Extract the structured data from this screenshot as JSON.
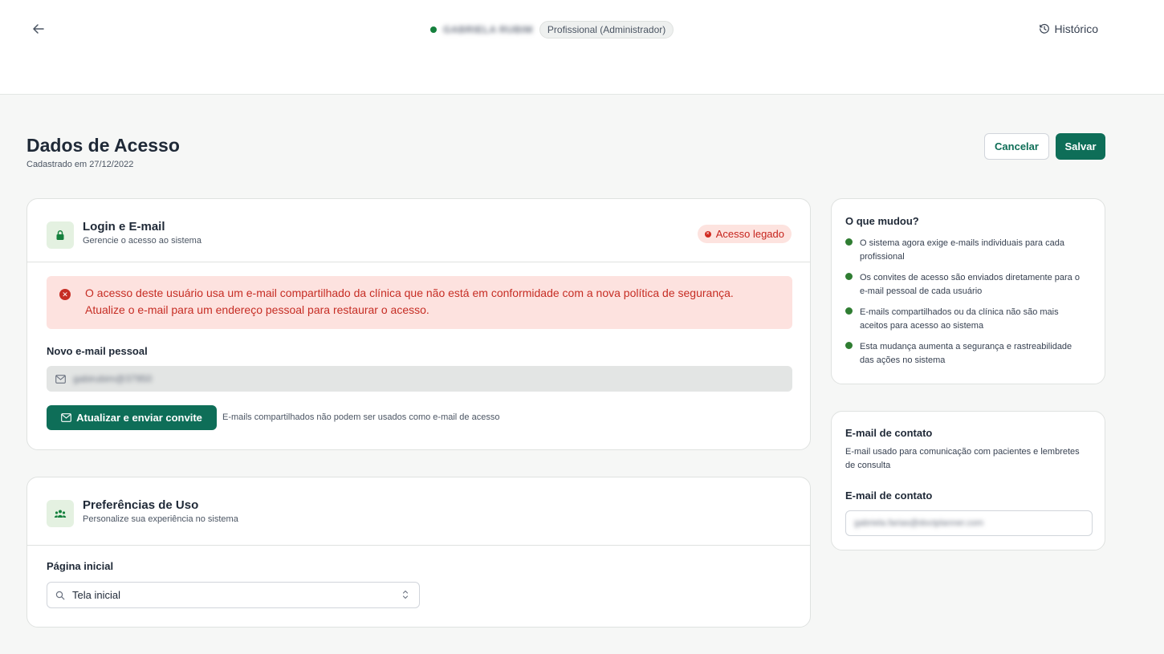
{
  "header": {
    "user_name": "GABRIELA RUBIM",
    "role": "Profissional (Administrador)",
    "history_label": "Histórico"
  },
  "page": {
    "title": "Dados de Acesso",
    "subtitle": "Cadastrado em 27/12/2022",
    "cancel_label": "Cancelar",
    "save_label": "Salvar"
  },
  "login": {
    "title": "Login e E-mail",
    "subtitle": "Gerencie o acesso ao sistema",
    "badge": "Acesso legado",
    "alert_line1": "O acesso deste usuário usa um e-mail compartilhado da clínica que não está em conformidade com a nova política de segurança.",
    "alert_line2": "Atualize o e-mail para um endereço pessoal para restaurar o acesso.",
    "email_label": "Novo e-mail pessoal",
    "email_value": "gabirubim@37950",
    "invite_label": "Atualizar e enviar convite",
    "invite_hint": "E-mails compartilhados não podem ser usados como e-mail de acesso"
  },
  "prefs": {
    "title": "Preferências de Uso",
    "subtitle": "Personalize sua experiência no sistema",
    "home_label": "Página inicial",
    "home_value": "Tela inicial"
  },
  "changes": {
    "title": "O que mudou?",
    "items": [
      "O sistema agora exige e-mails individuais para cada profissional",
      "Os convites de acesso são enviados diretamente para o e-mail pessoal de cada usuário",
      "E-mails compartilhados ou da clínica não são mais aceitos para acesso ao sistema",
      "Esta mudança aumenta a segurança e rastreabilidade das ações no sistema"
    ]
  },
  "contact": {
    "title": "E-mail de contato",
    "description": "E-mail usado para comunicação com pacientes e lembretes de consulta",
    "field_label": "E-mail de contato",
    "value": "gabriela.farias@doctplanner.com"
  },
  "colors": {
    "primary": "#0e6e58",
    "danger": "#c62d24",
    "danger_bg": "#fde2df",
    "success": "#2f7d32",
    "icon_bg": "#e4f1e1"
  },
  "icons": {
    "back": "arrow-left-icon",
    "history": "history-clock-icon",
    "lock": "lock-icon",
    "users": "users-icon",
    "mail": "mail-icon",
    "search": "search-icon",
    "error": "x-circle-icon",
    "check": "check-circle-icon",
    "chevrons": "chevron-up-down-icon"
  }
}
